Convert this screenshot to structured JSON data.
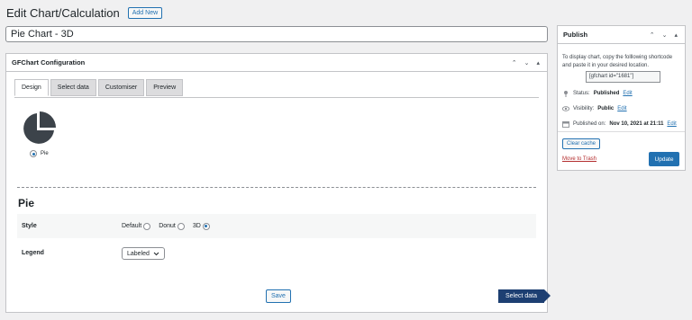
{
  "page": {
    "title": "Edit Chart/Calculation",
    "add_new_label": "Add New",
    "chart_title_value": "Pie Chart - 3D"
  },
  "config": {
    "box_title": "GFChart Configuration",
    "header_icons": [
      "chevron-up-icon",
      "chevron-down-icon",
      "triangle-up-icon"
    ],
    "tabs": [
      {
        "label": "Design",
        "active": true
      },
      {
        "label": "Select data",
        "active": false
      },
      {
        "label": "Customiser",
        "active": false
      },
      {
        "label": "Preview",
        "active": false
      }
    ],
    "chart_type_label": "Pie",
    "section_heading": "Pie",
    "style": {
      "label": "Style",
      "options": [
        {
          "label": "Default",
          "checked": false
        },
        {
          "label": "Donut",
          "checked": false
        },
        {
          "label": "3D",
          "checked": true
        }
      ]
    },
    "legend": {
      "label": "Legend",
      "selected": "Labeled"
    },
    "save_label": "Save",
    "select_data_label": "Select data"
  },
  "publish": {
    "box_title": "Publish",
    "instructions": "To display chart, copy the folllowing shortcode and paste it in your desired location.",
    "shortcode": "[gfchart id=\"1681\"]",
    "status_label": "Status:",
    "status_value": "Published",
    "visibility_label": "Visibility:",
    "visibility_value": "Public",
    "published_label": "Published on:",
    "published_value": "Nov 10, 2021 at 21:11",
    "edit_label": "Edit",
    "clear_cache_label": "Clear cache",
    "trash_label": "Move to Trash",
    "update_label": "Update"
  },
  "colors": {
    "accent": "#2271b1",
    "pie_fill": "#3c434a",
    "select_data_bg": "#1d3f72",
    "trash": "#b32d2e"
  }
}
